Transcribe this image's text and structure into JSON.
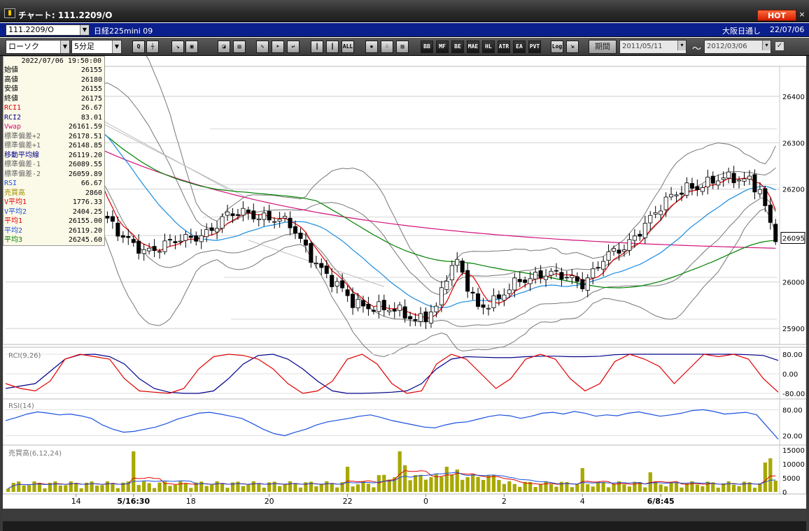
{
  "window": {
    "title": "チャート: 111.2209/O",
    "hot_label": "HOT",
    "close_glyph": "×"
  },
  "toolbar1": {
    "symbol": "111.2209/O",
    "instrument": "日経225mini 09",
    "session": "大阪日通し",
    "date": "22/07/06"
  },
  "toolbar2": {
    "chart_type": "ローソク",
    "timeframe": "5分足",
    "period_label": "期間",
    "date_from": "2011/05/11",
    "date_to": "2012/03/06",
    "range_sep": "〜",
    "tools": [
      {
        "name": "zoom-tool",
        "text": "Q"
      },
      {
        "name": "crosshair-tool",
        "text": "┼"
      },
      {
        "name": "draw-line-tool",
        "text": "↘"
      },
      {
        "name": "chart-tool-a",
        "text": "▣"
      },
      {
        "name": "chart-tool-b",
        "text": "◪"
      },
      {
        "name": "chart-tool-c",
        "text": "▤"
      },
      {
        "name": "pen-tool",
        "text": "✎"
      },
      {
        "name": "cursor-tool",
        "text": "➤"
      },
      {
        "name": "undo-tool",
        "text": "↩"
      },
      {
        "name": "candle-tool-a",
        "text": "┃"
      },
      {
        "name": "candle-tool-b",
        "text": "┃"
      },
      {
        "name": "all-button",
        "text": "ALL"
      },
      {
        "name": "settings-tool",
        "text": "✺"
      },
      {
        "name": "brush-tool",
        "text": "♧"
      },
      {
        "name": "color-tool",
        "text": "▨"
      },
      {
        "name": "bb-button",
        "text": "BB"
      },
      {
        "name": "mf-button",
        "text": "MF"
      },
      {
        "name": "be-button",
        "text": "BE"
      },
      {
        "name": "mae-button",
        "text": "MAE"
      },
      {
        "name": "hl-button",
        "text": "HL"
      },
      {
        "name": "atr-button",
        "text": "ATR"
      },
      {
        "name": "ea-button",
        "text": "EA"
      },
      {
        "name": "pvt-button",
        "text": "PVT"
      },
      {
        "name": "log-button",
        "text": "Log"
      },
      {
        "name": "export-tool",
        "text": "⇲"
      }
    ]
  },
  "info": {
    "timestamp": "2022/07/06  19:50:00",
    "rows": [
      {
        "label": "始値",
        "value": "26155",
        "color": "#000000"
      },
      {
        "label": "高値",
        "value": "26180",
        "color": "#000000"
      },
      {
        "label": "安値",
        "value": "26155",
        "color": "#000000"
      },
      {
        "label": "終値",
        "value": "26175",
        "color": "#000000"
      },
      {
        "label": "RCI1",
        "value": "26.67",
        "color": "#e00000"
      },
      {
        "label": "RCI2",
        "value": "83.01",
        "color": "#00008b"
      },
      {
        "label": "Vwap",
        "value": "26161.59",
        "color": "#d0107a"
      },
      {
        "label": "標準偏差+2",
        "value": "26178.51",
        "color": "#666666"
      },
      {
        "label": "標準偏差+1",
        "value": "26148.85",
        "color": "#666666"
      },
      {
        "label": "移動平均線",
        "value": "26119.20",
        "color": "#00008b"
      },
      {
        "label": "標準偏差-1",
        "value": "26089.55",
        "color": "#666666"
      },
      {
        "label": "標準偏差-2",
        "value": "26059.89",
        "color": "#666666"
      },
      {
        "label": "RSI",
        "value": "66.67",
        "color": "#1a50e0"
      },
      {
        "label": "売買高",
        "value": "2860",
        "color": "#a09000"
      },
      {
        "label": "V平均1",
        "value": "1776.33",
        "color": "#e00000"
      },
      {
        "label": "V平均2",
        "value": "2404.25",
        "color": "#1a50e0"
      },
      {
        "label": "平均1",
        "value": "26155.00",
        "color": "#e00000"
      },
      {
        "label": "平均2",
        "value": "26119.20",
        "color": "#1a50e0"
      },
      {
        "label": "平均3",
        "value": "26245.60",
        "color": "#008000"
      }
    ]
  },
  "chart_data": {
    "type": "candlestick",
    "price_axis": {
      "min": 25870,
      "max": 26460,
      "ticks": [
        26400,
        26300,
        26200,
        26100,
        26000,
        25900
      ]
    },
    "last_price": "26095",
    "colors": {
      "bull": "#ffffff",
      "bear": "#000000",
      "ma1": "#e00000",
      "ma2": "#1a8ce0",
      "ma3": "#008000",
      "vwap": "#d0107a",
      "bb": "#777777",
      "trend": "#bbbbbb",
      "rci1": "#e00000",
      "rci2": "#00008b",
      "rsi": "#1a50e0",
      "vol": "#a8a800",
      "vma1": "#e00000",
      "vma2": "#1a50e0"
    },
    "x_labels": [
      {
        "text": "14",
        "i": 13,
        "bold": false
      },
      {
        "text": "5/16:30",
        "i": 24,
        "bold": true
      },
      {
        "text": "18",
        "i": 35,
        "bold": false
      },
      {
        "text": "20",
        "i": 50,
        "bold": false
      },
      {
        "text": "22",
        "i": 65,
        "bold": false
      },
      {
        "text": "0",
        "i": 80,
        "bold": false
      },
      {
        "text": "2",
        "i": 95,
        "bold": false
      },
      {
        "text": "4",
        "i": 110,
        "bold": false
      },
      {
        "text": "6/8:45",
        "i": 125,
        "bold": true
      }
    ],
    "close_anchors": [
      [
        0,
        26395
      ],
      [
        6,
        26385
      ],
      [
        10,
        26330
      ],
      [
        14,
        26280
      ],
      [
        18,
        26150
      ],
      [
        22,
        26090
      ],
      [
        26,
        26070
      ],
      [
        30,
        26080
      ],
      [
        34,
        26090
      ],
      [
        38,
        26110
      ],
      [
        42,
        26140
      ],
      [
        46,
        26150
      ],
      [
        50,
        26140
      ],
      [
        54,
        26120
      ],
      [
        58,
        26060
      ],
      [
        62,
        26000
      ],
      [
        66,
        25955
      ],
      [
        70,
        25950
      ],
      [
        74,
        25935
      ],
      [
        78,
        25920
      ],
      [
        82,
        25945
      ],
      [
        84,
        26010
      ],
      [
        86,
        26040
      ],
      [
        90,
        25950
      ],
      [
        94,
        25960
      ],
      [
        98,
        26005
      ],
      [
        102,
        26020
      ],
      [
        106,
        26010
      ],
      [
        110,
        26000
      ],
      [
        114,
        26050
      ],
      [
        118,
        26070
      ],
      [
        122,
        26130
      ],
      [
        126,
        26170
      ],
      [
        130,
        26205
      ],
      [
        134,
        26215
      ],
      [
        138,
        26220
      ],
      [
        142,
        26225
      ],
      [
        144,
        26200
      ],
      [
        146,
        26120
      ],
      [
        147,
        26095
      ]
    ],
    "rci": {
      "label": "RCI(9,26)",
      "ticks": [
        80,
        0,
        -80
      ],
      "tick_labels": [
        "80.00",
        "0.00",
        "-80.00"
      ],
      "rci1": [
        -40,
        -60,
        -70,
        -30,
        60,
        80,
        70,
        60,
        -20,
        -70,
        -75,
        -80,
        -60,
        20,
        70,
        80,
        75,
        60,
        20,
        -40,
        -80,
        -70,
        -30,
        60,
        80,
        40,
        -40,
        -80,
        -70,
        40,
        80,
        60,
        0,
        -60,
        -20,
        60,
        80,
        60,
        -20,
        -70,
        -40,
        50,
        80,
        60,
        30,
        -40,
        20,
        80,
        70,
        80,
        60,
        -20,
        -75
      ],
      "rci2": [
        -60,
        -50,
        -40,
        10,
        60,
        78,
        80,
        70,
        40,
        -20,
        -60,
        -75,
        -80,
        -80,
        -70,
        -20,
        40,
        75,
        80,
        60,
        20,
        -30,
        -70,
        -80,
        -80,
        -78,
        -75,
        -70,
        -40,
        20,
        60,
        70,
        68,
        66,
        66,
        70,
        72,
        72,
        70,
        70,
        72,
        78,
        80,
        80,
        80,
        80,
        80,
        80,
        80,
        80,
        78,
        75,
        55
      ]
    },
    "rsi": {
      "label": "RSI(14)",
      "ticks": [
        80,
        20
      ],
      "tick_labels": [
        "80.00",
        "20.00"
      ],
      "values": [
        55,
        62,
        70,
        75,
        72,
        68,
        70,
        66,
        60,
        45,
        35,
        28,
        30,
        35,
        40,
        48,
        58,
        65,
        72,
        74,
        70,
        65,
        60,
        48,
        35,
        25,
        20,
        28,
        35,
        45,
        52,
        56,
        60,
        65,
        68,
        62,
        55,
        50,
        45,
        40,
        38,
        45,
        50,
        52,
        58,
        64,
        68,
        66,
        60,
        65,
        72,
        74,
        70,
        76,
        72,
        65,
        68,
        66,
        72,
        75,
        70,
        65,
        68,
        72,
        78,
        80,
        76,
        70,
        72,
        74,
        68,
        40,
        12
      ]
    },
    "volume": {
      "label": "売買高(6,12,24)",
      "ticks": [
        15000,
        10000,
        5000,
        0
      ],
      "tick_labels": [
        "15000",
        "10000",
        "5000",
        "0"
      ],
      "max": 16000
    }
  }
}
